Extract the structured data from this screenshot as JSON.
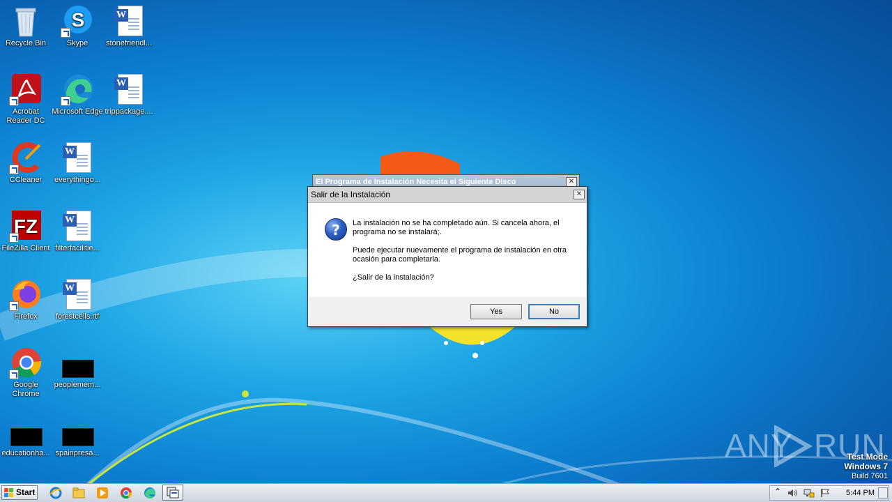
{
  "desktop": {
    "icons": [
      {
        "label": "Recycle Bin"
      },
      {
        "label": "Skype"
      },
      {
        "label": "stonefriendl..."
      },
      {
        "label": "Acrobat Reader DC"
      },
      {
        "label": "Microsoft Edge"
      },
      {
        "label": "trippackage...."
      },
      {
        "label": "CCleaner"
      },
      {
        "label": "everythingo..."
      },
      {
        "label": "FileZilla Client"
      },
      {
        "label": "filterfacilitie..."
      },
      {
        "label": "Firefox"
      },
      {
        "label": "forestcells.rtf"
      },
      {
        "label": "Google Chrome"
      },
      {
        "label": "peoplemem..."
      },
      {
        "label": "educationha..."
      },
      {
        "label": "spainpresa..."
      }
    ]
  },
  "background_dialog": {
    "title": "El Programa de Instalación Necesita el Siguiente Disco",
    "close_glyph": "✕"
  },
  "dialog": {
    "title": "Salir de la Instalación",
    "close_glyph": "✕",
    "icon_glyph": "?",
    "message_1": "La instalación no se ha completado aún. Si cancela ahora, el programa no se instalará;.",
    "message_2": "Puede ejecutar nuevamente el programa de instalación en otra ocasión para completarla.",
    "message_3": "¿Salir de la instalación?",
    "yes_label": "Yes",
    "no_label": "No"
  },
  "watermark": {
    "text_left": "ANY",
    "text_right": "RUN"
  },
  "test_mode": {
    "line1": "Test Mode",
    "line2": "Windows 7",
    "line3": "Build 7601"
  },
  "taskbar": {
    "start_label": "Start",
    "clock": "5:44 PM"
  },
  "colors": {
    "accent": "#3c7fb1",
    "desktop": "#1ea7e6"
  }
}
